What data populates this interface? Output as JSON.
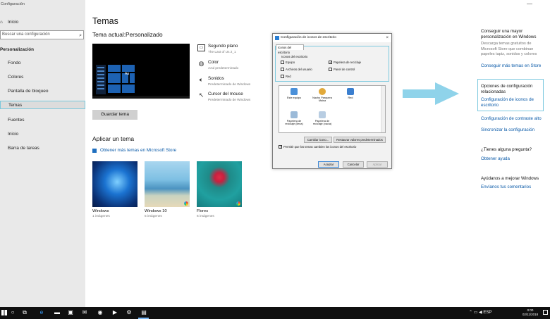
{
  "window": {
    "app_title": "Configuración",
    "minimize": "—"
  },
  "sidebar": {
    "home": "Inicio",
    "search_placeholder": "Buscar una configuración",
    "section": "Personalización",
    "items": [
      {
        "label": "Fondo",
        "icon": "image-icon"
      },
      {
        "label": "Colores",
        "icon": "palette-icon"
      },
      {
        "label": "Pantalla de bloqueo",
        "icon": "lock-screen-icon"
      },
      {
        "label": "Temas",
        "icon": "brush-icon",
        "selected": true
      },
      {
        "label": "Fuentes",
        "icon": "font-icon"
      },
      {
        "label": "Inicio",
        "icon": "start-icon"
      },
      {
        "label": "Barra de tareas",
        "icon": "taskbar-icon"
      }
    ]
  },
  "main": {
    "title": "Temas",
    "current_theme": "Tema actual:Personalizado",
    "preview_aa": "Aa",
    "settings": [
      {
        "title": "Segundo plano",
        "subtitle": "The Last of Us 2_1",
        "icon": "background-icon"
      },
      {
        "title": "Color",
        "subtitle": "Azul predeterminado",
        "icon": "palette-icon"
      },
      {
        "title": "Sonidos",
        "subtitle": "Predeterminado de Windows",
        "icon": "speaker-icon"
      },
      {
        "title": "Cursor del mouse",
        "subtitle": "Predeterminado de Windows",
        "icon": "cursor-icon"
      }
    ],
    "save_button": "Guardar tema",
    "apply_title": "Aplicar un tema",
    "store_link": "Obtener más temas en Microsoft Store",
    "themes": [
      {
        "name": "Windows",
        "count": "1 imágenes"
      },
      {
        "name": "Windows 10",
        "count": "5 imágenes"
      },
      {
        "name": "Flores",
        "count": "6 imágenes"
      }
    ]
  },
  "dialog": {
    "title": "Configuración de iconos de escritorio",
    "close": "×",
    "tab": "Iconos del escritorio",
    "group_title": "Iconos del escritorio",
    "checkboxes": [
      {
        "label": "Equipo",
        "checked": false
      },
      {
        "label": "Archivos del usuario",
        "checked": false
      },
      {
        "label": "Red",
        "checked": false
      },
      {
        "label": "Papelera de reciclaje",
        "checked": true
      },
      {
        "label": "Panel de control",
        "checked": false
      }
    ],
    "icons": [
      {
        "label": "Este equipo"
      },
      {
        "label": "Nacho Parquera Malsa"
      },
      {
        "label": "Red"
      },
      {
        "label": "Papelera de reciclaje (llena)"
      },
      {
        "label": "Papelera de reciclaje (vacía)"
      }
    ],
    "change_icon": "Cambiar icono...",
    "restore": "Restaurar valores predeterminados",
    "allow_themes": "Permitir que los temas cambien los iconos del escritorio",
    "allow_checked": true,
    "ok": "Aceptar",
    "cancel": "Cancelar",
    "apply": "Aplicar"
  },
  "right": {
    "section1_title": "Conseguir una mayor personalización en Windows",
    "section1_text": "Descarga temas gratuitos de Microsoft Store que combinan papeles tapiz, sonidos y colores",
    "section1_link": "Conseguir más temas en Store",
    "section2_title": "Opciones de configuración relacionadas",
    "section2_link1": "Configuración de iconos de escritorio",
    "section2_link2": "Configuración de contraste alto",
    "section2_link3": "Sincronizar la configuración",
    "section3_title": "¿Tienes alguna pregunta?",
    "section3_link": "Obtener ayuda",
    "section4_title": "Ayúdanos a mejorar Windows",
    "section4_link": "Envíanos tus comentarios"
  },
  "taskbar": {
    "system_tray": "ESP",
    "time": "0:00",
    "date": "02/11/2018"
  },
  "colors": {
    "highlight": "#7cc9df",
    "link": "#0a5aa8",
    "arrow": "#8fd3ea"
  }
}
